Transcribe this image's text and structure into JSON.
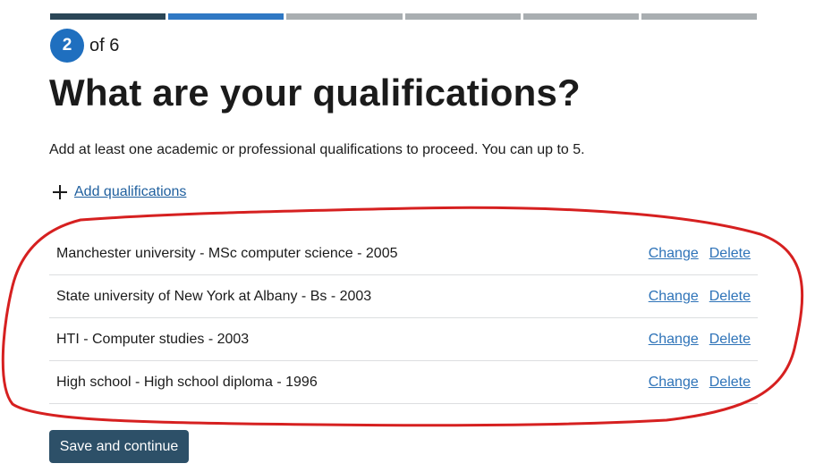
{
  "progress": {
    "total_steps": 6,
    "current_step": 2,
    "step_number": "2",
    "of_label": "of 6"
  },
  "page": {
    "title": "What are your qualifications?",
    "intro": "Add at least one academic or professional qualifications to proceed. You can up to 5."
  },
  "add_link": {
    "label": "Add qualifications"
  },
  "qualifications": [
    {
      "text": "Manchester university - MSc computer science - 2005",
      "change": "Change",
      "delete": "Delete"
    },
    {
      "text": "State university of New York at Albany - Bs - 2003",
      "change": "Change",
      "delete": "Delete"
    },
    {
      "text": "HTI - Computer studies - 2003",
      "change": "Change",
      "delete": "Delete"
    },
    {
      "text": "High school - High school diploma - 1996",
      "change": "Change",
      "delete": "Delete"
    }
  ],
  "actions": {
    "save_label": "Save and continue"
  },
  "colors": {
    "progress_done": "#2b4657",
    "progress_current": "#2f78c4",
    "progress_todo": "#a9aeb1",
    "link": "#2e73b8",
    "button": "#2d5068",
    "annotation": "#d62020"
  }
}
